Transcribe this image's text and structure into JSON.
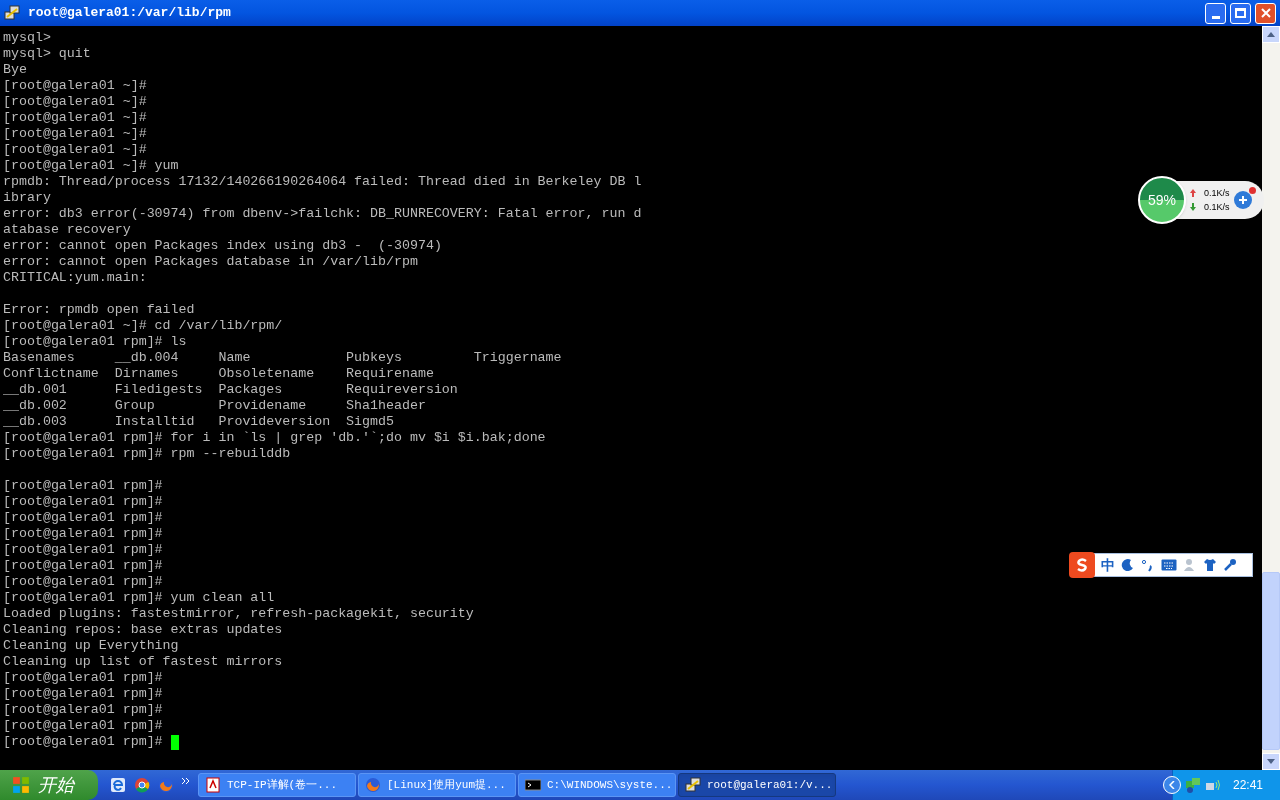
{
  "window": {
    "title": "root@galera01:/var/lib/rpm"
  },
  "terminal": {
    "lines": [
      {
        "kind": "text",
        "text": "mysql>"
      },
      {
        "kind": "text",
        "text": "mysql> quit"
      },
      {
        "kind": "text",
        "text": "Bye"
      },
      {
        "kind": "text",
        "text": "[root@galera01 ~]#"
      },
      {
        "kind": "text",
        "text": "[root@galera01 ~]#"
      },
      {
        "kind": "text",
        "text": "[root@galera01 ~]#"
      },
      {
        "kind": "text",
        "text": "[root@galera01 ~]#"
      },
      {
        "kind": "text",
        "text": "[root@galera01 ~]#"
      },
      {
        "kind": "text",
        "text": "[root@galera01 ~]# yum"
      },
      {
        "kind": "text",
        "text": "rpmdb: Thread/process 17132/140266190264064 failed: Thread died in Berkeley DB l"
      },
      {
        "kind": "text",
        "text": "ibrary"
      },
      {
        "kind": "text",
        "text": "error: db3 error(-30974) from dbenv->failchk: DB_RUNRECOVERY: Fatal error, run d"
      },
      {
        "kind": "text",
        "text": "atabase recovery"
      },
      {
        "kind": "text",
        "text": "error: cannot open Packages index using db3 -  (-30974)"
      },
      {
        "kind": "text",
        "text": "error: cannot open Packages database in /var/lib/rpm"
      },
      {
        "kind": "text",
        "text": "CRITICAL:yum.main:"
      },
      {
        "kind": "blank"
      },
      {
        "kind": "text",
        "text": "Error: rpmdb open failed"
      },
      {
        "kind": "text",
        "text": "[root@galera01 ~]# cd /var/lib/rpm/"
      },
      {
        "kind": "text",
        "text": "[root@galera01 rpm]# ls"
      },
      {
        "kind": "text",
        "text": "Basenames     __db.004     Name            Pubkeys         Triggername"
      },
      {
        "kind": "text",
        "text": "Conflictname  Dirnames     Obsoletename    Requirename"
      },
      {
        "kind": "text",
        "text": "__db.001      Filedigests  Packages        Requireversion"
      },
      {
        "kind": "text",
        "text": "__db.002      Group        Providename     Sha1header"
      },
      {
        "kind": "text",
        "text": "__db.003      Installtid   Provideversion  Sigmd5"
      },
      {
        "kind": "text",
        "text": "[root@galera01 rpm]# for i in `ls | grep 'db.'`;do mv $i $i.bak;done"
      },
      {
        "kind": "text",
        "text": "[root@galera01 rpm]# rpm --rebuilddb"
      },
      {
        "kind": "blank"
      },
      {
        "kind": "text",
        "text": "[root@galera01 rpm]#"
      },
      {
        "kind": "text",
        "text": "[root@galera01 rpm]#"
      },
      {
        "kind": "text",
        "text": "[root@galera01 rpm]#"
      },
      {
        "kind": "text",
        "text": "[root@galera01 rpm]#"
      },
      {
        "kind": "text",
        "text": "[root@galera01 rpm]#"
      },
      {
        "kind": "text",
        "text": "[root@galera01 rpm]#"
      },
      {
        "kind": "text",
        "text": "[root@galera01 rpm]#"
      },
      {
        "kind": "text",
        "text": "[root@galera01 rpm]# yum clean all"
      },
      {
        "kind": "text",
        "text": "Loaded plugins: fastestmirror, refresh-packagekit, security"
      },
      {
        "kind": "text",
        "text": "Cleaning repos: base extras updates"
      },
      {
        "kind": "text",
        "text": "Cleaning up Everything"
      },
      {
        "kind": "text",
        "text": "Cleaning up list of fastest mirrors"
      },
      {
        "kind": "text",
        "text": "[root@galera01 rpm]#"
      },
      {
        "kind": "text",
        "text": "[root@galera01 rpm]#"
      },
      {
        "kind": "text",
        "text": "[root@galera01 rpm]#"
      },
      {
        "kind": "text",
        "text": "[root@galera01 rpm]#"
      },
      {
        "kind": "prompt",
        "text": "[root@galera01 rpm]# "
      }
    ]
  },
  "network_widget": {
    "usage": "59%",
    "upload": "0.1K/s",
    "download": "0.1K/s"
  },
  "ime_toolbar": {
    "mode": "中"
  },
  "taskbar": {
    "start": "开始",
    "tasks": [
      {
        "kind": "pdf",
        "label": "TCP-IP详解(卷一...",
        "selected": false
      },
      {
        "kind": "browser",
        "label": "[Linux]使用yum提...",
        "selected": false
      },
      {
        "kind": "console",
        "label": "C:\\WINDOWS\\syste...",
        "selected": false
      },
      {
        "kind": "putty",
        "label": "root@galera01:/v...",
        "selected": true
      }
    ],
    "clock": "22:41"
  }
}
